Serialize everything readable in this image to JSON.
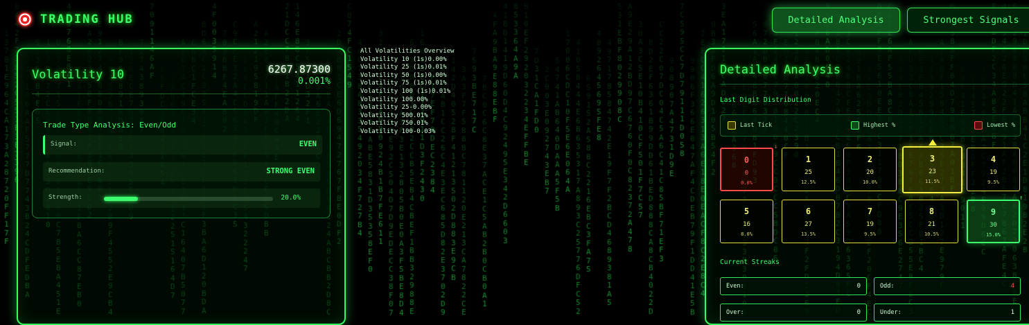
{
  "header": {
    "title": "TRADING HUB",
    "icon": "target-icon",
    "buttons": [
      {
        "label": "Detailed Analysis",
        "active": true
      },
      {
        "label": "Strongest Signals",
        "active": false
      }
    ]
  },
  "market": {
    "name": "Volatility 10",
    "price": "6267.87300",
    "change": "0.001%"
  },
  "trade_analysis": {
    "title": "Trade Type Analysis: Even/Odd",
    "signal_label": "Signal:",
    "signal_value": "EVEN",
    "recommendation_label": "Recommendation:",
    "recommendation_value": "STRONG EVEN",
    "strength_label": "Strength:",
    "strength_value": "20.0%",
    "strength_fraction": 0.2
  },
  "overview": {
    "title": "All Volatilities Overview",
    "items": [
      "Volatility 10 (1s)0.00%",
      "Volatility 25 (1s)0.01%",
      "Volatility 50 (1s)0.00%",
      "Volatility 75 (1s)0.01%",
      "Volatility 100 (1s)0.01%",
      "Volatility 100.00%",
      "Volatility 25-0.00%",
      "Volatility 500.01%",
      "Volatility 750.01%",
      "Volatility 100-0.03%"
    ]
  },
  "detail": {
    "title": "Detailed Analysis",
    "distribution_title": "Last Digit Distribution",
    "legend": {
      "last": "Last Tick",
      "highest": "Highest %",
      "lowest": "Lowest %"
    },
    "digits": [
      {
        "digit": "0",
        "count": "0",
        "percent": "0.0%",
        "state": "lowest"
      },
      {
        "digit": "1",
        "count": "25",
        "percent": "12.5%",
        "state": ""
      },
      {
        "digit": "2",
        "count": "20",
        "percent": "10.0%",
        "state": ""
      },
      {
        "digit": "3",
        "count": "23",
        "percent": "11.5%",
        "state": "last"
      },
      {
        "digit": "4",
        "count": "19",
        "percent": "9.5%",
        "state": ""
      },
      {
        "digit": "5",
        "count": "16",
        "percent": "8.0%",
        "state": ""
      },
      {
        "digit": "6",
        "count": "27",
        "percent": "13.5%",
        "state": ""
      },
      {
        "digit": "7",
        "count": "19",
        "percent": "9.5%",
        "state": ""
      },
      {
        "digit": "8",
        "count": "21",
        "percent": "10.5%",
        "state": ""
      },
      {
        "digit": "9",
        "count": "30",
        "percent": "15.0%",
        "state": "highest"
      }
    ],
    "arrows": {
      "down": "↓",
      "up": "↑"
    },
    "streaks_title": "Current Streaks",
    "streaks": [
      {
        "label": "Even:",
        "value": "0",
        "warn": false
      },
      {
        "label": "Odd:",
        "value": "4",
        "warn": true
      },
      {
        "label": "Over:",
        "value": "0",
        "warn": false
      },
      {
        "label": "Under:",
        "value": "1",
        "warn": false
      }
    ]
  },
  "colors": {
    "accent": "#3dff6d",
    "last_tick": "#f3ef3a",
    "lowest": "#ff4a4a",
    "background": "#000000"
  }
}
